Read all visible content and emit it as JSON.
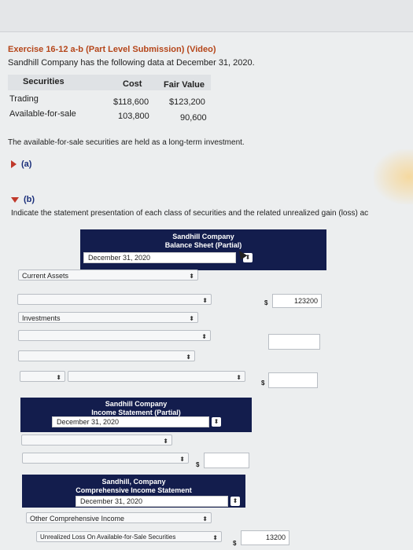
{
  "exercise_title": "Exercise 16-12 a-b (Part Level Submission) (Video)",
  "intro": "Sandhill Company has the following data at December 31, 2020.",
  "table": {
    "headers": [
      "Securities",
      "Cost",
      "Fair Value"
    ],
    "rows": [
      {
        "label": "Trading",
        "cost": "$118,600",
        "fair": "$123,200"
      },
      {
        "label": "Available-for-sale",
        "cost": "103,800",
        "fair": "90,600"
      }
    ]
  },
  "note": "The available-for-sale securities are held as a long-term investment.",
  "part_a": "(a)",
  "part_b": "(b)",
  "instructions": "Indicate the statement presentation of each class of securities and the related unrealized gain (loss) ac",
  "balance_sheet": {
    "line1": "Sandhill Company",
    "line2": "Balance Sheet (Partial)",
    "date": "December 31, 2020",
    "current_assets": "Current Assets",
    "investments": "Investments",
    "trading_amount": "123200"
  },
  "income_statement": {
    "line1": "Sandhill Company",
    "line2": "Income Statement (Partial)",
    "date": "December 31, 2020"
  },
  "comprehensive": {
    "line1": "Sandhill, Company",
    "line2": "Comprehensive Income Statement",
    "date": "December 31, 2020",
    "oci_label": "Other Comprehensive Income",
    "loss_label": "Unrealized Loss On Available-for-Sale Securities",
    "loss_amount": "13200"
  },
  "symbols": {
    "dollar": "$",
    "arrow": "⬍"
  }
}
